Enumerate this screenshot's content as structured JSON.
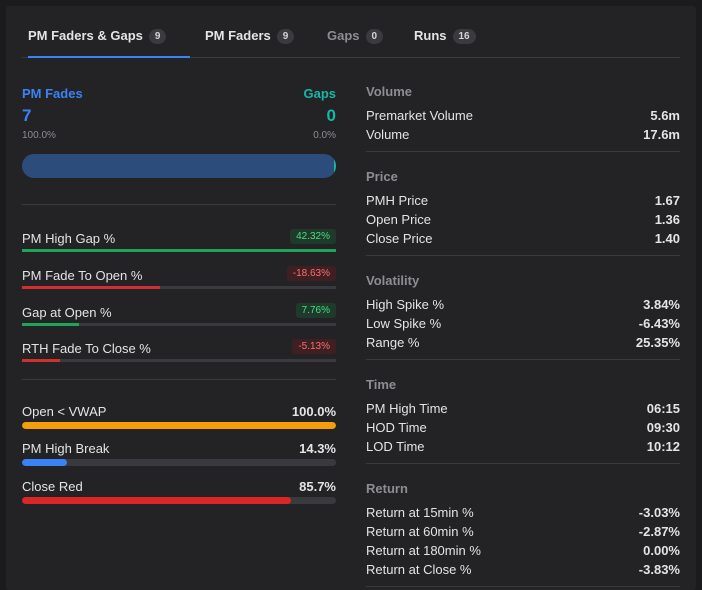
{
  "tabs": [
    {
      "label": "PM Faders & Gaps",
      "count": "9"
    },
    {
      "label": "PM Faders",
      "count": "9"
    },
    {
      "label": "Gaps",
      "count": "0"
    },
    {
      "label": "Runs",
      "count": "16"
    }
  ],
  "summary": {
    "left_label": "PM Fades",
    "left_count": "7",
    "left_pct": "100.0%",
    "right_label": "Gaps",
    "right_count": "0",
    "right_pct": "0.0%",
    "left_fraction": 1.0
  },
  "metrics": [
    {
      "label": "PM High Gap %",
      "value": "42.32%",
      "sign": "pos",
      "fill_fraction": 1.0
    },
    {
      "label": "PM Fade To Open %",
      "value": "-18.63%",
      "sign": "neg",
      "fill_fraction": 0.44
    },
    {
      "label": "Gap at Open %",
      "value": "7.76%",
      "sign": "pos",
      "fill_fraction": 0.18
    },
    {
      "label": "RTH Fade To Close %",
      "value": "-5.13%",
      "sign": "neg",
      "fill_fraction": 0.12
    }
  ],
  "stats": [
    {
      "label": "Open < VWAP",
      "value": "100.0%",
      "fraction": 1.0,
      "color": "#f59e0b"
    },
    {
      "label": "PM High Break",
      "value": "14.3%",
      "fraction": 0.143,
      "color": "#3b82f6"
    },
    {
      "label": "Close Red",
      "value": "85.7%",
      "fraction": 0.857,
      "color": "#dc2626"
    }
  ],
  "sections": [
    {
      "title": "Volume",
      "rows": [
        {
          "label": "Premarket Volume",
          "value": "5.6m"
        },
        {
          "label": "Volume",
          "value": "17.6m"
        }
      ]
    },
    {
      "title": "Price",
      "rows": [
        {
          "label": "PMH Price",
          "value": "1.67"
        },
        {
          "label": "Open Price",
          "value": "1.36"
        },
        {
          "label": "Close Price",
          "value": "1.40"
        }
      ]
    },
    {
      "title": "Volatility",
      "rows": [
        {
          "label": "High Spike %",
          "value": "3.84%"
        },
        {
          "label": "Low Spike %",
          "value": "-6.43%"
        },
        {
          "label": "Range %",
          "value": "25.35%"
        }
      ]
    },
    {
      "title": "Time",
      "rows": [
        {
          "label": "PM High Time",
          "value": "06:15"
        },
        {
          "label": "HOD Time",
          "value": "09:30"
        },
        {
          "label": "LOD Time",
          "value": "10:12"
        }
      ]
    },
    {
      "title": "Return",
      "rows": [
        {
          "label": "Return at 15min %",
          "value": "-3.03%"
        },
        {
          "label": "Return at 60min %",
          "value": "-2.87%"
        },
        {
          "label": "Return at 180min %",
          "value": "0.00%"
        },
        {
          "label": "Return at Close %",
          "value": "-3.83%"
        }
      ]
    }
  ],
  "colors": {
    "accent": "#3b82f6",
    "teal": "#14b8a6",
    "positive": "#4ade80",
    "negative": "#f87171"
  }
}
